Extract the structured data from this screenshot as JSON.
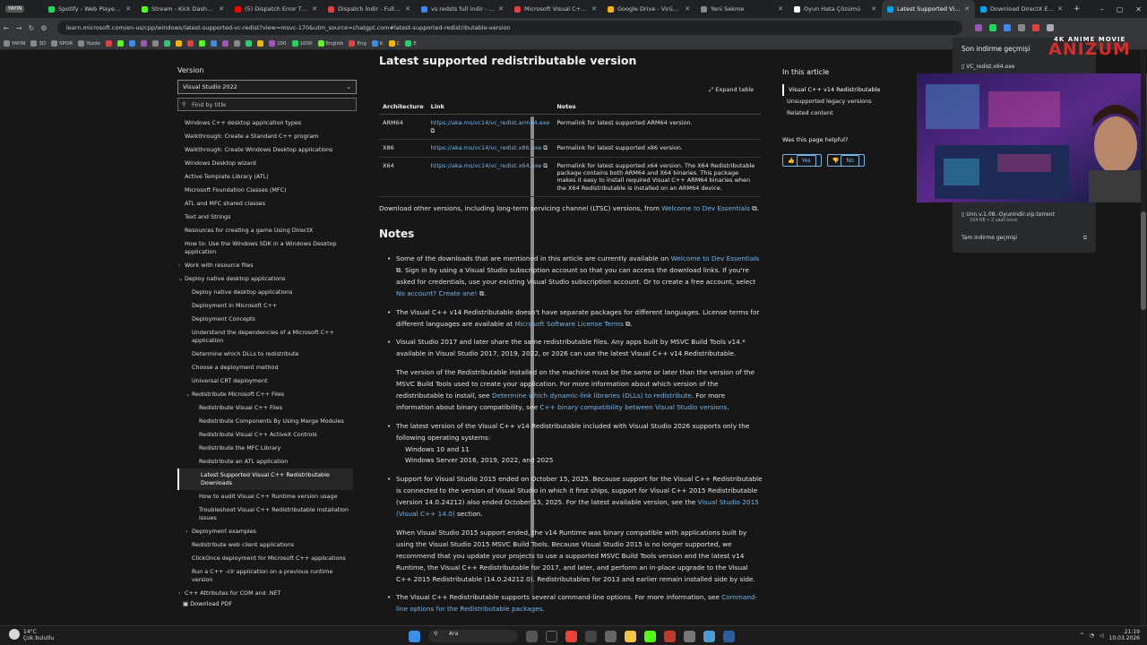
{
  "browser": {
    "tabs": [
      {
        "label": "Spotify - Web Player: Ho...",
        "color": "#1ed760"
      },
      {
        "label": "Stream - Kick Dashboard",
        "color": "#53fc18"
      },
      {
        "label": "(5) Dispatch Error The U...",
        "color": "#ff0000"
      },
      {
        "label": "Dispatch İndir - Full PC ...",
        "color": "#e04040"
      },
      {
        "label": "vs redsts full indir - Goo...",
        "color": "#4285f4"
      },
      {
        "label": "Microsoft Visual C++ Re...",
        "color": "#e04040"
      },
      {
        "label": "Google Drive - Virüs tar...",
        "color": "#f4b400"
      },
      {
        "label": "Yeni Sekme",
        "color": "#888888"
      },
      {
        "label": "Oyun Hata Çözümü",
        "color": "#ffffff"
      },
      {
        "label": "Latest Supported Visual ...",
        "color": "#00a4ef",
        "active": true
      },
      {
        "label": "Download DirectX End-...",
        "color": "#00a4ef"
      }
    ],
    "live_badge": "YAYIN",
    "url": "learn.microsoft.com/en-us/cpp/windows/latest-supported-vc-redist?view=msvc-170&utm_source=chatgpt.com#latest-supported-redistributable-version",
    "bookmarks": [
      "YAYIN",
      "3D",
      "SPOR",
      "Yüzde",
      "100",
      "1000",
      "English",
      "Eng",
      "K",
      "C",
      "E"
    ]
  },
  "sidebar": {
    "version_label": "Version",
    "version_value": "Visual Studio 2022",
    "filter_placeholder": "Find by title",
    "items": [
      {
        "label": "Windows C++ desktop application types",
        "level": 0
      },
      {
        "label": "Walkthrough: Create a Standard C++ program",
        "level": 0
      },
      {
        "label": "Walkthrough: Create Windows Desktop applications",
        "level": 0
      },
      {
        "label": "Windows Desktop wizard",
        "level": 0
      },
      {
        "label": "Active Template Library (ATL)",
        "level": 0
      },
      {
        "label": "Microsoft Foundation Classes (MFC)",
        "level": 0
      },
      {
        "label": "ATL and MFC shared classes",
        "level": 0
      },
      {
        "label": "Text and Strings",
        "level": 0
      },
      {
        "label": "Resources for creating a game Using DirectX",
        "level": 0
      },
      {
        "label": "How to: Use the Windows SDK in a Windows Desktop application",
        "level": 0
      },
      {
        "label": "Work with resource files",
        "level": 0,
        "expand": "closed"
      },
      {
        "label": "Deploy native desktop applications",
        "level": 0,
        "expand": "open"
      },
      {
        "label": "Deploy native desktop applications",
        "level": 1
      },
      {
        "label": "Deployment in Microsoft C++",
        "level": 1
      },
      {
        "label": "Deployment Concepts",
        "level": 1
      },
      {
        "label": "Understand the dependencies of a Microsoft C++ application",
        "level": 1
      },
      {
        "label": "Determine which DLLs to redistribute",
        "level": 1
      },
      {
        "label": "Choose a deployment method",
        "level": 1
      },
      {
        "label": "Universal CRT deployment",
        "level": 1
      },
      {
        "label": "Redistribute Microsoft C++ Files",
        "level": 1,
        "expand": "open"
      },
      {
        "label": "Redistribute Visual C++ Files",
        "level": 2
      },
      {
        "label": "Redistribute Components By Using Merge Modules",
        "level": 2
      },
      {
        "label": "Redistribute Visual C++ ActiveX Controls",
        "level": 2
      },
      {
        "label": "Redistribute the MFC Library",
        "level": 2
      },
      {
        "label": "Redistribute an ATL application",
        "level": 2
      },
      {
        "label": "Latest Supported Visual C++ Redistributable Downloads",
        "level": 2,
        "active": true
      },
      {
        "label": "How to audit Visual C++ Runtime version usage",
        "level": 2
      },
      {
        "label": "Troubleshoot Visual C++ Redistributable installation issues",
        "level": 2
      },
      {
        "label": "Deployment examples",
        "level": 1,
        "expand": "closed"
      },
      {
        "label": "Redistribute web client applications",
        "level": 1
      },
      {
        "label": "ClickOnce deployment for Microsoft C++ applications",
        "level": 1
      },
      {
        "label": "Run a C++ -clr application on a previous runtime version",
        "level": 1
      },
      {
        "label": "C++ Attributes for COM and .NET",
        "level": 0,
        "expand": "closed"
      }
    ],
    "download_pdf": "Download PDF"
  },
  "main": {
    "title": "Latest supported redistributable version",
    "expand_table": "Expand table",
    "table": {
      "headers": [
        "Architecture",
        "Link",
        "Notes"
      ],
      "rows": [
        {
          "arch": "ARM64",
          "link": "https://aka.ms/vc14/vc_redist.arm64.exe",
          "notes": "Permalink for latest supported ARM64 version."
        },
        {
          "arch": "X86",
          "link": "https://aka.ms/vc14/vc_redist.x86.exe",
          "notes": "Permalink for latest supported x86 version."
        },
        {
          "arch": "X64",
          "link": "https://aka.ms/vc14/vc_redist.x64.exe",
          "notes": "Permalink for latest supported x64 version. The X64 Redistributable package contains both ARM64 and X64 binaries. This package makes it easy to install required Visual C++ ARM64 binaries when the X64 Redistributable is installed on an ARM64 device."
        }
      ]
    },
    "download_other_pre": "Download other versions, including long-term servicing channel (LTSC) versions, from ",
    "download_other_link": "Welcome to Dev Essentials",
    "download_other_post": ".",
    "notes_heading": "Notes",
    "notes": {
      "n1_a": "Some of the downloads that are mentioned in this article are currently available on ",
      "n1_link": "Welcome to Dev Essentials",
      "n1_b": ". Sign in by using a Visual Studio subscription account so that you can access the download links. If you're asked for credentials, use your existing Visual Studio subscription account. Or to create a free account, select ",
      "n1_link2": "No account? Create one!",
      "n1_c": ".",
      "n2_a": "The Visual C++ v14 Redistributable doesn't have separate packages for different languages. License terms for different languages are available at ",
      "n2_link": "Microsoft Software License Terms",
      "n2_b": ".",
      "n3": "Visual Studio 2017 and later share the same redistributable files. Any apps built by MSVC Build Tools v14.* available in Visual Studio 2017, 2019, 2022, or 2026 can use the latest Visual C++ v14 Redistributable.",
      "n3b_a": "The version of the Redistributable installed on the machine must be the same or later than the version of the MSVC Build Tools used to create your application. For more information about which version of the redistributable to install, see ",
      "n3b_link": "Determine which dynamic-link libraries (DLLs) to redistribute",
      "n3b_b": ". For more information about binary compatibility, see ",
      "n3b_link2": "C++ binary compatibility between Visual Studio versions",
      "n3b_c": ".",
      "n4": "The latest version of the Visual C++ v14 Redistributable included with Visual Studio 2026 supports only the following operating systems:",
      "os": [
        "Windows 10 and 11",
        "Windows Server 2016, 2019, 2022, and 2025"
      ],
      "n5_a": "Support for Visual Studio 2015 ended on October 15, 2025. Because support for the Visual C++ Redistributable is connected to the version of Visual Studio in which it first ships, support for Visual C++ 2015 Redistributable (version 14.0.24212) also ended October 15, 2025. For the latest available version, see the ",
      "n5_link": "Visual Studio 2015 (Visual C++ 14.0)",
      "n5_b": " section.",
      "n5b": "When Visual Studio 2015 support ended, the v14 Runtime was binary compatible with applications built by using the Visual Studio 2015 MSVC Build Tools. Because Visual Studio 2015 is no longer supported, we recommend that you update your projects to use a supported MSVC Build Tools version and the latest v14 Runtime, the Visual C++ Redistributable for 2017, and later, and perform an in-place upgrade to the Visual C++ 2015 Redistributable (14.0.24212.0). Redistributables for 2013 and earlier remain installed side by side.",
      "n6_a": "The Visual C++ Redistributable supports several command-line options. For more information, see ",
      "n6_link": "Command-line options for the Redistributable packages",
      "n6_b": "."
    }
  },
  "right": {
    "title": "In this article",
    "items": [
      "Visual C++ v14 Redistributable",
      "Unsupported legacy versions",
      "Related content"
    ],
    "helpful": "Was this page helpful?",
    "yes": "Yes",
    "no": "No"
  },
  "downloads": {
    "header": "Son indirme geçmişi",
    "file1": "VC_redist.x64.exe",
    "file2": "Unn.v.1.08.-Oyunindir.vip.torrent",
    "file2_meta": "104 KB • 2 saat önce",
    "all": "Tam indirme geçmişi"
  },
  "overlay": {
    "brand": "ANIZUM",
    "brand_sub": "4K ANIME MOVIE"
  },
  "taskbar": {
    "temp": "14°C",
    "weather": "Çok bulutlu",
    "search": "Ara",
    "time": "21:19",
    "date": "10.03.2026"
  }
}
